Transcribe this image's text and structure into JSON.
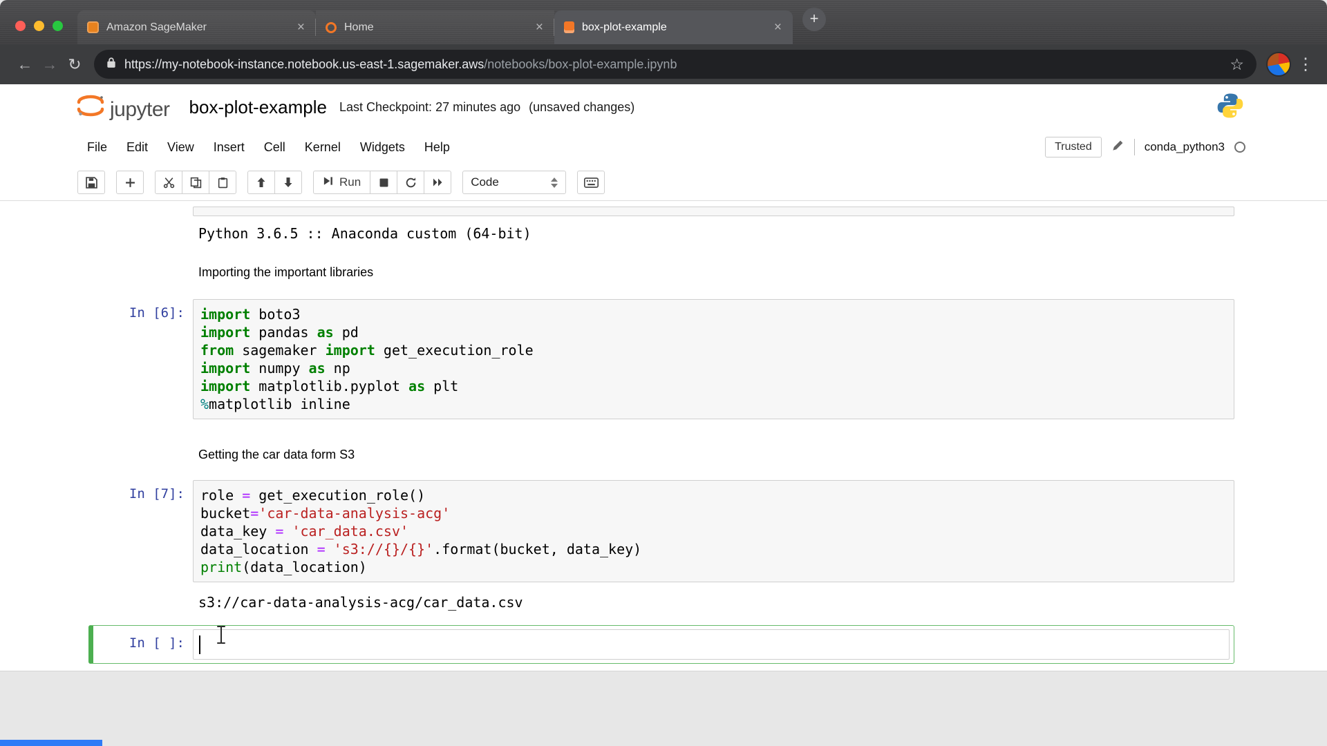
{
  "browser": {
    "tabs": [
      {
        "label": "Amazon SageMaker"
      },
      {
        "label": "Home"
      },
      {
        "label": "box-plot-example"
      }
    ],
    "close_glyph": "×",
    "new_tab_glyph": "+",
    "back_glyph": "←",
    "forward_glyph": "→",
    "reload_glyph": "↻",
    "url_host": "https://my-notebook-instance.notebook.us-east-1.sagemaker.aws",
    "url_path": "/notebooks/box-plot-example.ipynb",
    "star_glyph": "☆",
    "overflow_glyph": "⋮"
  },
  "jupyter": {
    "logo_text": "jupyter",
    "title": "box-plot-example",
    "checkpoint": "Last Checkpoint: 27 minutes ago",
    "status": "(unsaved changes)",
    "menus": [
      "File",
      "Edit",
      "View",
      "Insert",
      "Cell",
      "Kernel",
      "Widgets",
      "Help"
    ],
    "trusted_label": "Trusted",
    "kernel_name": "conda_python3",
    "toolbar": {
      "run_label": "Run",
      "cell_type": "Code"
    }
  },
  "notebook": {
    "cells": [
      {
        "type": "sliver"
      },
      {
        "type": "output",
        "text": "Python 3.6.5 :: Anaconda custom (64-bit)"
      },
      {
        "type": "markdown",
        "text": "Importing the important libraries"
      },
      {
        "type": "code",
        "prompt": "In [6]:",
        "lines": [
          [
            [
              "kw",
              "import"
            ],
            [
              "pl",
              " boto3"
            ]
          ],
          [
            [
              "kw",
              "import"
            ],
            [
              "pl",
              " pandas "
            ],
            [
              "kw",
              "as"
            ],
            [
              "pl",
              " pd"
            ]
          ],
          [
            [
              "kw",
              "from"
            ],
            [
              "pl",
              " sagemaker "
            ],
            [
              "kw",
              "import"
            ],
            [
              "pl",
              " get_execution_role"
            ]
          ],
          [
            [
              "kw",
              "import"
            ],
            [
              "pl",
              " numpy "
            ],
            [
              "kw",
              "as"
            ],
            [
              "pl",
              " np"
            ]
          ],
          [
            [
              "kw",
              "import"
            ],
            [
              "pl",
              " matplotlib.pyplot "
            ],
            [
              "kw",
              "as"
            ],
            [
              "pl",
              " plt"
            ]
          ],
          [
            [
              "mg",
              "%"
            ],
            [
              "pl",
              "matplotlib inline"
            ]
          ]
        ]
      },
      {
        "type": "markdown",
        "text": "Getting the car data form S3"
      },
      {
        "type": "code",
        "prompt": "In [7]:",
        "lines": [
          [
            [
              "pl",
              "role "
            ],
            [
              "op",
              "="
            ],
            [
              "pl",
              " get_execution_role()"
            ]
          ],
          [
            [
              "pl",
              "bucket"
            ],
            [
              "op",
              "="
            ],
            [
              "st",
              "'car-data-analysis-acg'"
            ]
          ],
          [
            [
              "pl",
              "data_key "
            ],
            [
              "op",
              "="
            ],
            [
              "pl",
              " "
            ],
            [
              "st",
              "'car_data.csv'"
            ]
          ],
          [
            [
              "pl",
              "data_location "
            ],
            [
              "op",
              "="
            ],
            [
              "pl",
              " "
            ],
            [
              "st",
              "'s3://{}/{}'"
            ],
            [
              "pl",
              ".format(bucket, data_key)"
            ]
          ],
          [
            [
              "bi",
              "print"
            ],
            [
              "pl",
              "(data_location)"
            ]
          ]
        ],
        "output": "s3://car-data-analysis-acg/car_data.csv"
      },
      {
        "type": "empty-code",
        "prompt": "In [ ]:",
        "selected": true
      }
    ]
  },
  "colors": {
    "selected_cell_green": "#66bb6a",
    "prompt_blue": "#303f9f",
    "keyword_green": "#008000",
    "string_red": "#ba2121",
    "operator_purple": "#aa22ff",
    "jupyter_orange": "#f37726"
  }
}
